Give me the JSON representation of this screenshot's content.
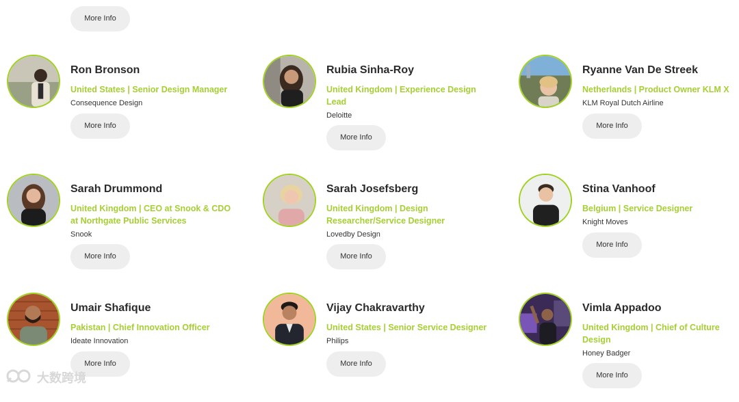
{
  "top_button": {
    "label": "More Info"
  },
  "cards": [
    {
      "name": "Ron Bronson",
      "role": "United States | Senior Design Manager",
      "company": "Consequence Design",
      "button": "More Info"
    },
    {
      "name": "Rubia Sinha-Roy",
      "role": "United Kingdom | Experience Design Lead",
      "company": "Deloitte",
      "button": "More Info"
    },
    {
      "name": "Ryanne Van De Streek",
      "role": "Netherlands | Product Owner KLM X",
      "company": "KLM Royal Dutch Airline",
      "button": "More Info"
    },
    {
      "name": "Sarah Drummond",
      "role": "United Kingdom | CEO at Snook & CDO at Northgate Public Services",
      "company": "Snook",
      "button": "More Info"
    },
    {
      "name": "Sarah Josefsberg",
      "role": "United Kingdom | Design Researcher/Service Designer",
      "company": "Lovedby Design",
      "button": "More Info"
    },
    {
      "name": "Stina Vanhoof",
      "role": "Belgium | Service Designer",
      "company": "Knight Moves",
      "button": "More Info"
    },
    {
      "name": "Umair Shafique",
      "role": "Pakistan | Chief Innovation Officer",
      "company": "Ideate Innovation",
      "button": "More Info"
    },
    {
      "name": "Vijay Chakravarthy",
      "role": "United States | Senior Service Designer",
      "company": "Philips",
      "button": "More Info"
    },
    {
      "name": "Vimla Appadoo",
      "role": "United Kingdom | Chief of Culture Design",
      "company": "Honey Badger",
      "button": "More Info"
    }
  ],
  "watermark": {
    "text": "大数跨境",
    "icon": "logo-icon"
  },
  "colors": {
    "accent": "#a6cf34",
    "ring": "#9fd11e",
    "button_bg": "#eeeeee"
  }
}
